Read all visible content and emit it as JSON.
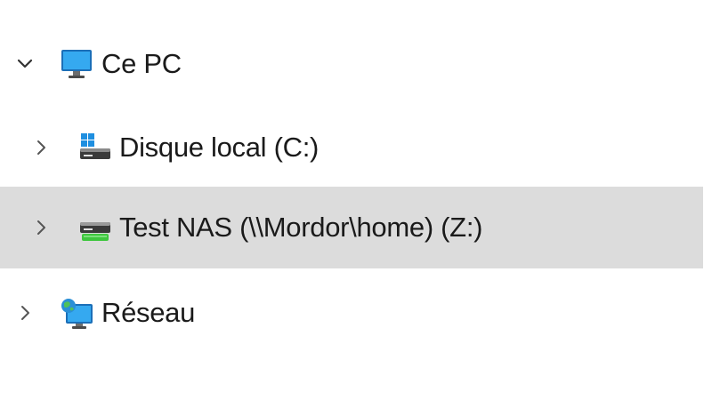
{
  "tree": {
    "items": [
      {
        "label": "Ce PC",
        "icon": "monitor-icon",
        "expanded": true,
        "selected": false
      },
      {
        "label": "Disque local (C:)",
        "icon": "windows-drive-icon",
        "expanded": false,
        "selected": false
      },
      {
        "label": "Test NAS (\\\\Mordor\\home) (Z:)",
        "icon": "network-drive-icon",
        "expanded": false,
        "selected": true
      },
      {
        "label": "Réseau",
        "icon": "network-icon",
        "expanded": false,
        "selected": false
      }
    ]
  },
  "colors": {
    "selected_row": "#dcdcdc",
    "drive_green": "#3ec63e",
    "windows_blue": "#1f8fe0",
    "monitor_blue": "#2a9be8"
  }
}
